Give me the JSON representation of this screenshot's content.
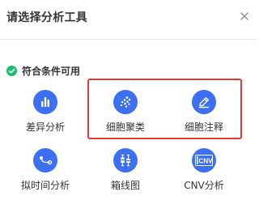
{
  "dialog": {
    "title": "请选择分析工具",
    "close_glyph": "×"
  },
  "section": {
    "label": "符合条件可用",
    "icon": "check-circle-icon",
    "icon_color": "#19be6b"
  },
  "accent_color": "#3d6ff2",
  "highlight_color": "#e53935",
  "tools": [
    {
      "label": "差异分析",
      "icon": "bar-chart-icon"
    },
    {
      "label": "细胞聚类",
      "icon": "cluster-dots-icon"
    },
    {
      "label": "细胞注释",
      "icon": "pencil-edit-icon"
    },
    {
      "label": "拟时间分析",
      "icon": "trajectory-icon"
    },
    {
      "label": "箱线图",
      "icon": "boxplot-icon"
    },
    {
      "label": "CNV分析",
      "icon": "cnv-icon"
    }
  ]
}
